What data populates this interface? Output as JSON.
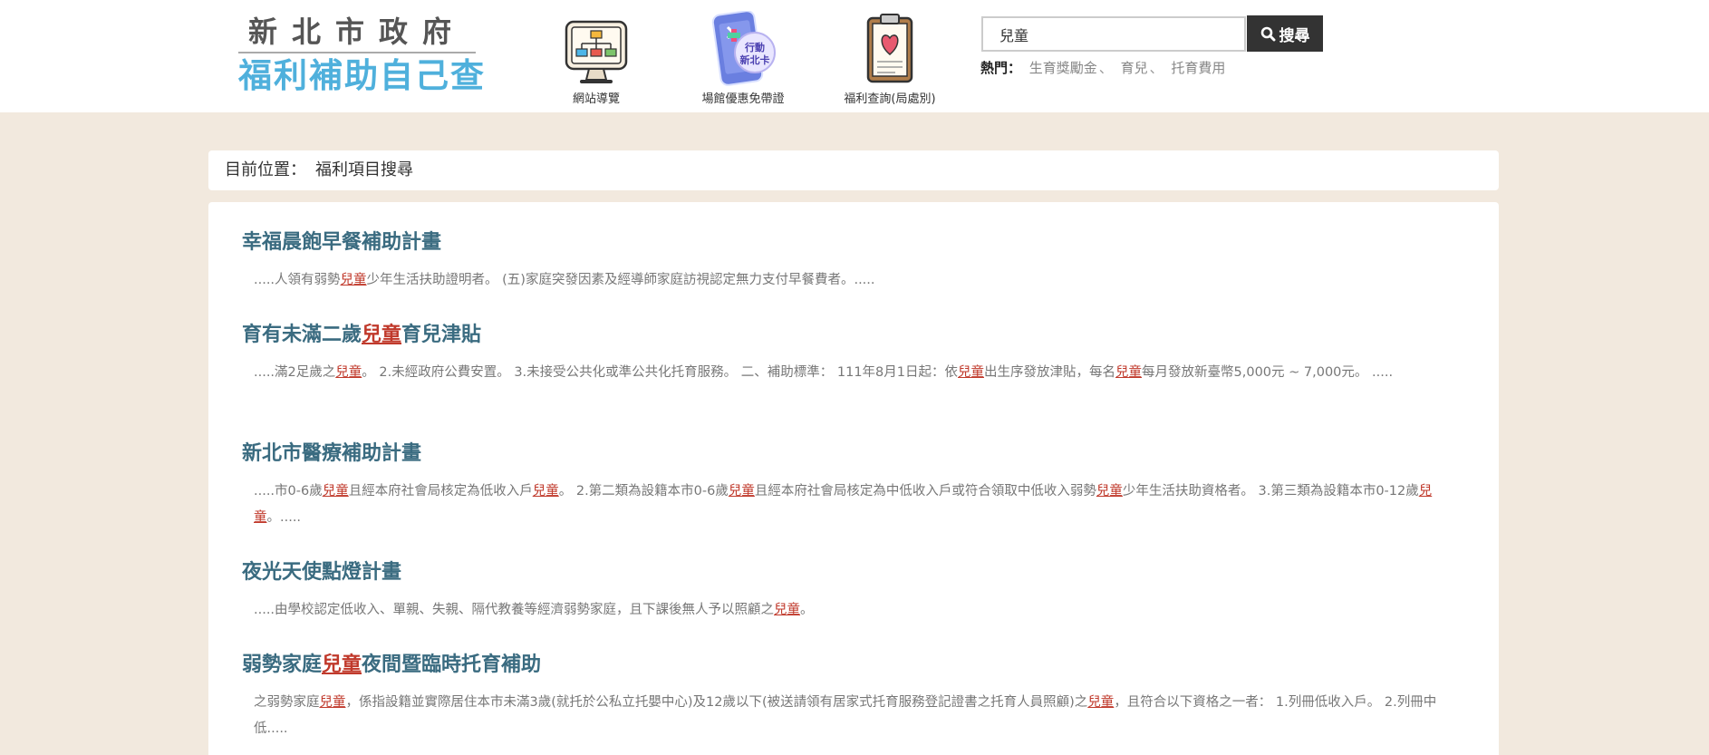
{
  "logo": {
    "line1": "新北市政府",
    "line2": "福利補助自己查"
  },
  "nav": [
    {
      "label": "網站導覽",
      "icon": "sitemap-monitor-icon"
    },
    {
      "label": "場館優惠免帶證",
      "icon": "mobile-card-icon",
      "badge_line1": "行動",
      "badge_line2": "新北卡"
    },
    {
      "label": "福利查詢(局處別)",
      "icon": "clipboard-heart-icon"
    }
  ],
  "search": {
    "value": "兒童",
    "button_label": "搜尋"
  },
  "hot": {
    "label": "熱門：",
    "items": [
      "生育獎勵金",
      "育兒",
      "托育費用"
    ],
    "separator": "、"
  },
  "breadcrumb": {
    "label": "目前位置：",
    "current": "福利項目搜尋"
  },
  "results": [
    {
      "title": [
        [
          "幸福晨飽早餐補助計畫",
          false
        ]
      ],
      "snippet": [
        [
          ".....人領有弱勢",
          false
        ],
        [
          "兒童",
          true
        ],
        [
          "少年生活扶助證明者。 (五)家庭突發因素及經導師家庭訪視認定無力支付早餐費者。.....",
          false
        ]
      ]
    },
    {
      "title": [
        [
          "育有未滿二歲",
          false
        ],
        [
          "兒童",
          true
        ],
        [
          "育兒津貼",
          false
        ]
      ],
      "snippet": [
        [
          ".....滿2足歲之",
          false
        ],
        [
          "兒童",
          true
        ],
        [
          "。 2.未經政府公費安置。 3.未接受公共化或準公共化托育服務。 二、補助標準： 111年8月1日起：依",
          false
        ],
        [
          "兒童",
          true
        ],
        [
          "出生序發放津貼，每名",
          false
        ],
        [
          "兒童",
          true
        ],
        [
          "每月發放新臺幣5,000元 ~ 7,000元。 .....",
          false
        ]
      ]
    },
    {
      "title": [
        [
          "新北市醫療補助計畫",
          false
        ]
      ],
      "snippet": [
        [
          ".....市0-6歲",
          false
        ],
        [
          "兒童",
          true
        ],
        [
          "且經本府社會局核定為低收入戶",
          false
        ],
        [
          "兒童",
          true
        ],
        [
          "。 2.第二類為設籍本市0-6歲",
          false
        ],
        [
          "兒童",
          true
        ],
        [
          "且經本府社會局核定為中低收入戶或符合領取中低收入弱勢",
          false
        ],
        [
          "兒童",
          true
        ],
        [
          "少年生活扶助資格者。 3.第三類為設籍本市0-12歲",
          false
        ],
        [
          "兒童",
          true
        ],
        [
          "。.....",
          false
        ]
      ]
    },
    {
      "title": [
        [
          "夜光天使點燈計畫",
          false
        ]
      ],
      "snippet": [
        [
          ".....由學校認定低收入、單親、失親、隔代教養等經濟弱勢家庭，且下課後無人予以照顧之",
          false
        ],
        [
          "兒童",
          true
        ],
        [
          "。",
          false
        ]
      ]
    },
    {
      "title": [
        [
          "弱勢家庭",
          false
        ],
        [
          "兒童",
          true
        ],
        [
          "夜間暨臨時托育補助",
          false
        ]
      ],
      "snippet": [
        [
          "之弱勢家庭",
          false
        ],
        [
          "兒童",
          true
        ],
        [
          "，係指設籍並實際居住本市未滿3歲(就托於公私立托嬰中心)及12歲以下(被送請領有居家式托育服務登記證書之托育人員照顧)之",
          false
        ],
        [
          "兒童",
          true
        ],
        [
          "，且符合以下資格之一者： 1.列冊低收入戶。 2.列冊中低.....",
          false
        ]
      ]
    }
  ]
}
